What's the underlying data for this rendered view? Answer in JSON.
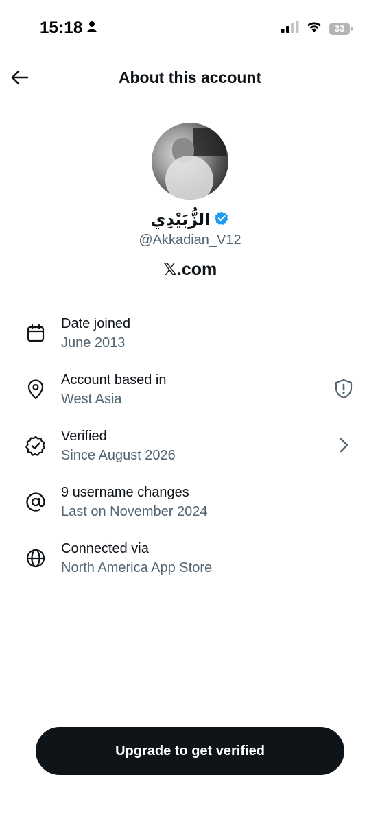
{
  "status_bar": {
    "time": "15:18",
    "battery": "33"
  },
  "header": {
    "title": "About this account"
  },
  "profile": {
    "display_name": "الزُّبَيْدِي",
    "handle": "@Akkadian_V12",
    "site": "𝕏.com",
    "verified_color": "#1d9bf0"
  },
  "info": [
    {
      "icon": "calendar-icon",
      "label": "Date joined",
      "value": "June 2013"
    },
    {
      "icon": "location-pin-icon",
      "label": "Account based in",
      "value": "West Asia",
      "trailing": "shield-icon"
    },
    {
      "icon": "verified-badge-icon",
      "label": "Verified",
      "value": "Since August 2026",
      "trailing": "chevron-right-icon"
    },
    {
      "icon": "at-sign-icon",
      "label": "9 username changes",
      "value": "Last on November 2024"
    },
    {
      "icon": "globe-icon",
      "label": "Connected via",
      "value": "North America App Store"
    }
  ],
  "cta": {
    "label": "Upgrade to get verified"
  },
  "colors": {
    "primary_text": "#0f1419",
    "secondary_text": "#536471",
    "button_bg": "#0f1419"
  }
}
